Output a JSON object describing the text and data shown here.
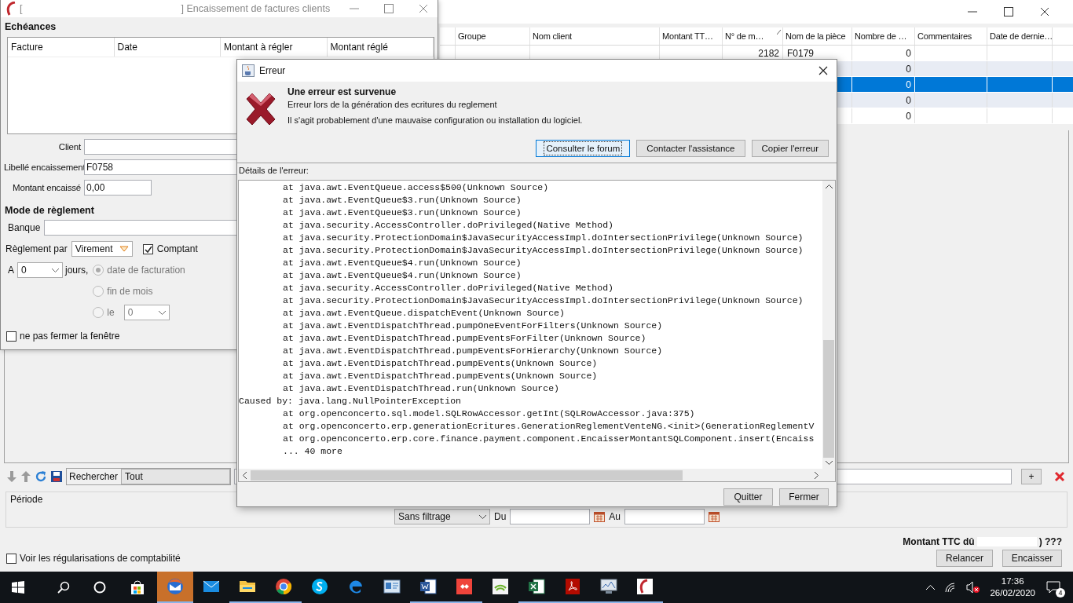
{
  "main_window": {
    "columns": [
      {
        "label": "Groupe",
        "sorted": false
      },
      {
        "label": "Nom client",
        "sorted": false
      },
      {
        "label": "Montant TT…",
        "sorted": false
      },
      {
        "label": "N° de m…",
        "sorted": true
      },
      {
        "label": "Nom de la pièce",
        "sorted": false
      },
      {
        "label": "Nombre de …",
        "sorted": false
      },
      {
        "label": "Commentaires",
        "sorted": false
      },
      {
        "label": "Date de dernie…",
        "sorted": false
      }
    ],
    "rows": [
      {
        "numero": "2182",
        "piece": "F0179",
        "nombre": "0",
        "selected": false
      },
      {
        "nombre": "0",
        "selected": false
      },
      {
        "nombre": "0",
        "selected": true
      },
      {
        "nombre": "0",
        "selected": false
      },
      {
        "nombre": "0",
        "selected": false
      }
    ],
    "search_label": "Rechercher",
    "scope": "Tout",
    "add": "+",
    "period": {
      "label": "Période",
      "filter": "Sans filtrage",
      "from_label": "Du",
      "to_label": "Au"
    },
    "total": {
      "label": "Montant TTC dû",
      "value": ") ???"
    },
    "regularisations": {
      "label": "Voir les régularisations de comptabilité",
      "checked": false
    },
    "buttons": [
      "Relancer",
      "Encaisser"
    ]
  },
  "invoice_window": {
    "title_left": "[",
    "title": "] Encaissement de factures clients",
    "echeances_title": "Echéances",
    "columns": [
      "Facture",
      "Date",
      "Montant à régler",
      "Montant réglé"
    ],
    "client_label": "Client",
    "libelle_label": "Libellé encaissement",
    "libelle": "F0758",
    "montant_label": "Montant encaissé",
    "montant": "0,00",
    "mode_title": "Mode de règlement",
    "banque_label": "Banque",
    "reglement_label": "Règlement par",
    "reglement": "Virement",
    "comptant": {
      "label": "Comptant",
      "checked": true
    },
    "delay_label": "A",
    "delay": "0",
    "days_label": "jours,",
    "options": [
      {
        "label": "date de facturation",
        "selected": true,
        "disabled": true
      },
      {
        "label": "fin de mois",
        "selected": false,
        "disabled": true
      },
      {
        "label": "le",
        "selected": false,
        "disabled": true
      }
    ],
    "day": "0",
    "keep_open": {
      "label": "ne pas fermer la fenêtre",
      "checked": false
    }
  },
  "error_dialog": {
    "title": "Erreur",
    "heading": "Une erreur est survenue",
    "message": "Erreur lors de la génération des ecritures du reglement",
    "hint": "Il s'agit probablement d'une mauvaise configuration ou installation du logiciel.",
    "actions": [
      {
        "label": "Consulter le forum",
        "focused": true
      },
      {
        "label": "Contacter l'assistance",
        "focused": false
      },
      {
        "label": "Copier l'erreur",
        "focused": false
      }
    ],
    "details_label": "Détails de l'erreur:",
    "trace": [
      {
        "kind": "frame",
        "text": "at java.awt.EventQueue.access$500(Unknown Source)"
      },
      {
        "kind": "frame",
        "text": "at java.awt.EventQueue$3.run(Unknown Source)"
      },
      {
        "kind": "frame",
        "text": "at java.awt.EventQueue$3.run(Unknown Source)"
      },
      {
        "kind": "frame",
        "text": "at java.security.AccessController.doPrivileged(Native Method)"
      },
      {
        "kind": "frame",
        "text": "at java.security.ProtectionDomain$JavaSecurityAccessImpl.doIntersectionPrivilege(Unknown Source)"
      },
      {
        "kind": "frame",
        "text": "at java.security.ProtectionDomain$JavaSecurityAccessImpl.doIntersectionPrivilege(Unknown Source)"
      },
      {
        "kind": "frame",
        "text": "at java.awt.EventQueue$4.run(Unknown Source)"
      },
      {
        "kind": "frame",
        "text": "at java.awt.EventQueue$4.run(Unknown Source)"
      },
      {
        "kind": "frame",
        "text": "at java.security.AccessController.doPrivileged(Native Method)"
      },
      {
        "kind": "frame",
        "text": "at java.security.ProtectionDomain$JavaSecurityAccessImpl.doIntersectionPrivilege(Unknown Source)"
      },
      {
        "kind": "frame",
        "text": "at java.awt.EventQueue.dispatchEvent(Unknown Source)"
      },
      {
        "kind": "frame",
        "text": "at java.awt.EventDispatchThread.pumpOneEventForFilters(Unknown Source)"
      },
      {
        "kind": "frame",
        "text": "at java.awt.EventDispatchThread.pumpEventsForFilter(Unknown Source)"
      },
      {
        "kind": "frame",
        "text": "at java.awt.EventDispatchThread.pumpEventsForHierarchy(Unknown Source)"
      },
      {
        "kind": "frame",
        "text": "at java.awt.EventDispatchThread.pumpEvents(Unknown Source)"
      },
      {
        "kind": "frame",
        "text": "at java.awt.EventDispatchThread.pumpEvents(Unknown Source)"
      },
      {
        "kind": "frame",
        "text": "at java.awt.EventDispatchThread.run(Unknown Source)"
      },
      {
        "kind": "cause",
        "text": "Caused by: java.lang.NullPointerException"
      },
      {
        "kind": "frame",
        "text": "at org.openconcerto.sql.model.SQLRowAccessor.getInt(SQLRowAccessor.java:375)"
      },
      {
        "kind": "frame",
        "text": "at org.openconcerto.erp.generationEcritures.GenerationReglementVenteNG.<init>(GenerationReglementV"
      },
      {
        "kind": "frame",
        "text": "at org.openconcerto.erp.core.finance.payment.component.EncaisserMontantSQLComponent.insert(Encaiss"
      },
      {
        "kind": "frame",
        "text": "... 40 more"
      }
    ],
    "buttons": [
      "Quitter",
      "Fermer"
    ]
  },
  "taskbar": {
    "apps": [
      {
        "kind": "mail-client",
        "open": true,
        "flashing": true
      },
      {
        "kind": "envelope",
        "open": false,
        "flashing": false
      },
      {
        "kind": "folder",
        "open": true,
        "flashing": false
      },
      {
        "kind": "browser",
        "open": true,
        "flashing": false
      },
      {
        "kind": "chat",
        "open": false,
        "flashing": false
      },
      {
        "kind": "edge",
        "open": false,
        "flashing": false
      },
      {
        "kind": "card",
        "open": false,
        "flashing": false
      },
      {
        "kind": "document",
        "open": true,
        "flashing": false
      },
      {
        "kind": "remote",
        "open": true,
        "flashing": false
      },
      {
        "kind": "network",
        "open": false,
        "flashing": false
      },
      {
        "kind": "spreadsheet",
        "open": true,
        "flashing": false
      },
      {
        "kind": "pdf",
        "open": true,
        "flashing": false
      },
      {
        "kind": "monitor",
        "open": true,
        "flashing": false
      },
      {
        "kind": "app",
        "open": true,
        "flashing": false
      }
    ],
    "time": "17:36",
    "date": "26/02/2020",
    "notifications": "4"
  }
}
